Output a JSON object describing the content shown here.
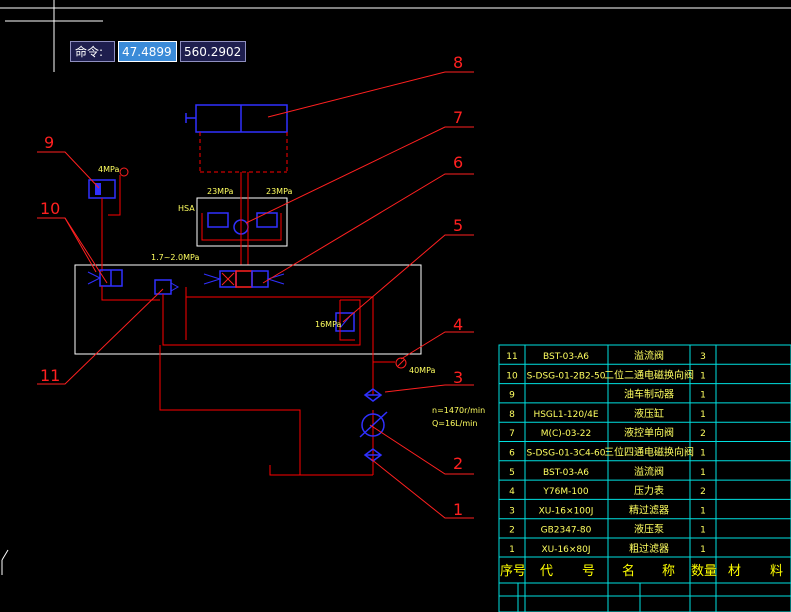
{
  "command_line": {
    "label": "命令:",
    "x": "47.4899",
    "y": "560.2902"
  },
  "callouts": [
    "1",
    "2",
    "3",
    "4",
    "5",
    "6",
    "7",
    "8",
    "9",
    "10",
    "11"
  ],
  "annotations": {
    "p9": "4MPa",
    "p7a": "23MPa",
    "p7b": "23MPa",
    "valve7_tag": "HSA",
    "range": "1.7~2.0MPa",
    "p5": "16MPa",
    "p4": "40MPa",
    "speed": "n=1470r/min",
    "flow": "Q=16L/min"
  },
  "bom": {
    "headers": [
      "序号",
      "代",
      "号",
      "名",
      "称",
      "数量",
      "材",
      "料"
    ],
    "rows": [
      {
        "no": "11",
        "code": "BST-03-A6",
        "name": "溢流阀",
        "qty": "3"
      },
      {
        "no": "10",
        "code": "S-DSG-01-2B2-50",
        "name": "二位二通电磁换向阀",
        "qty": "1"
      },
      {
        "no": "9",
        "code": "",
        "name": "油车制动器",
        "qty": "1"
      },
      {
        "no": "8",
        "code": "HSGL1-120/4E",
        "name": "液压缸",
        "qty": "1"
      },
      {
        "no": "7",
        "code": "M(C)-03-22",
        "name": "液控单向阀",
        "qty": "2"
      },
      {
        "no": "6",
        "code": "S-DSG-01-3C4-60",
        "name": "三位四通电磁换向阀",
        "qty": "1"
      },
      {
        "no": "5",
        "code": "BST-03-A6",
        "name": "溢流阀",
        "qty": "1"
      },
      {
        "no": "4",
        "code": "Y76M-100",
        "name": "压力表",
        "qty": "2"
      },
      {
        "no": "3",
        "code": "XU-16×100J",
        "name": "精过滤器",
        "qty": "1"
      },
      {
        "no": "2",
        "code": "GB2347-80",
        "name": "液压泵",
        "qty": "1"
      },
      {
        "no": "1",
        "code": "XU-16×80J",
        "name": "粗过滤器",
        "qty": "1"
      }
    ]
  },
  "colors": {
    "background": "#000000",
    "line": "#ff0000",
    "leader": "#ff2020",
    "component": "#2a2aff",
    "table_line": "#00e0e0",
    "table_text": "#ffff60",
    "header_text": "#ffff00",
    "white": "#ffffff"
  }
}
